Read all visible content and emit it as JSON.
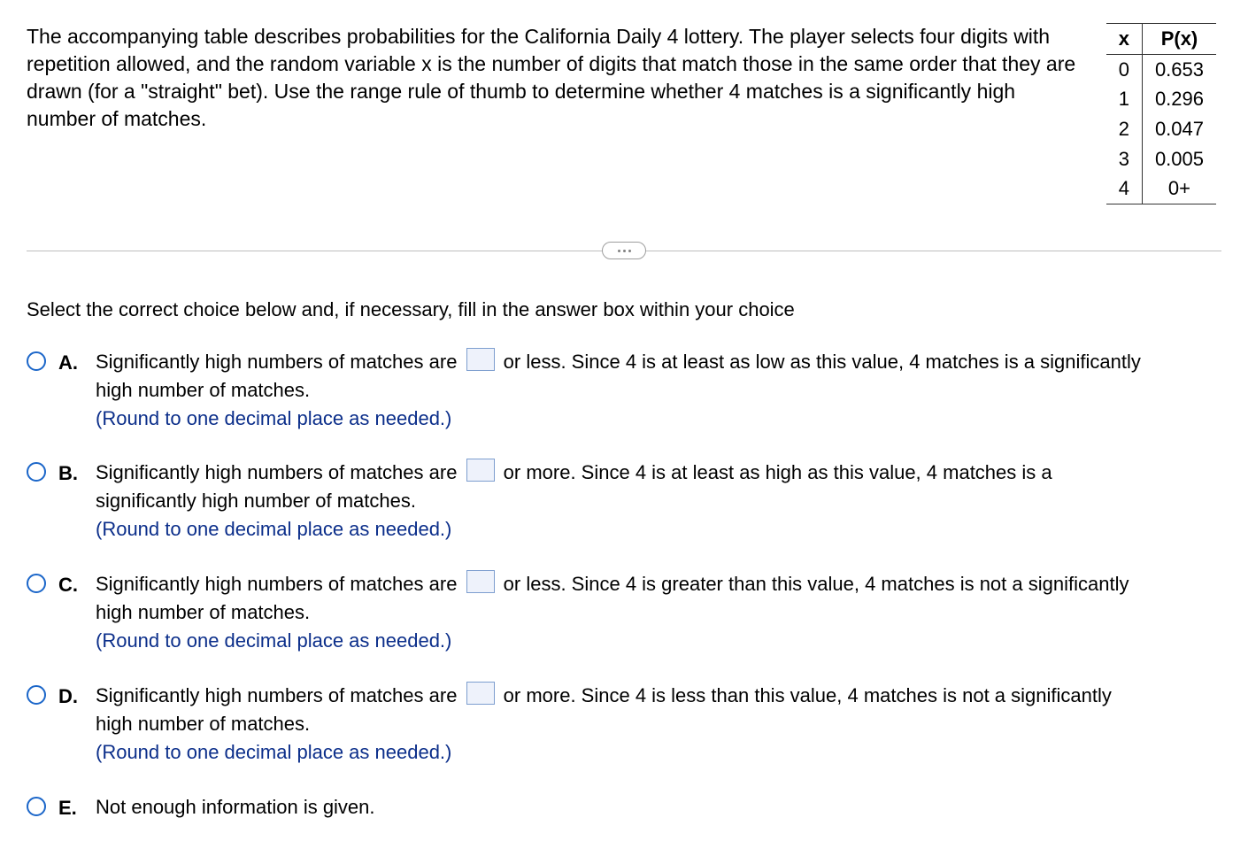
{
  "question": {
    "prompt": "The accompanying table describes probabilities for the California Daily 4 lottery. The player selects four digits with repetition allowed, and the random variable x is the number of digits that match those in the same order that they are drawn (for a \"straight\" bet). Use the range rule of thumb to determine whether 4 matches is a significantly high number of matches.",
    "table": {
      "headers": {
        "x": "x",
        "px": "P(x)"
      },
      "rows": [
        {
          "x": "0",
          "px": "0.653"
        },
        {
          "x": "1",
          "px": "0.296"
        },
        {
          "x": "2",
          "px": "0.047"
        },
        {
          "x": "3",
          "px": "0.005"
        },
        {
          "x": "4",
          "px": "0+"
        }
      ]
    },
    "instruction": "Select the correct choice below and, if necessary, fill in the answer box within your choice",
    "hint": "(Round to one decimal place as needed.)",
    "choices": {
      "A": {
        "pre": "Significantly high numbers of matches are ",
        "post": " or less. Since 4 is at least as low as this value, 4 matches is a significantly high number of matches.",
        "has_box": true
      },
      "B": {
        "pre": "Significantly high numbers of matches are ",
        "post": " or more. Since 4 is at least as high as this value, 4 matches is a significantly high number of matches.",
        "has_box": true
      },
      "C": {
        "pre": "Significantly high numbers of matches are ",
        "post": " or less. Since 4 is greater than this value, 4 matches is not a significantly high number of matches.",
        "has_box": true
      },
      "D": {
        "pre": "Significantly high numbers of matches are ",
        "post": " or more. Since 4 is less than this value, 4 matches is not a significantly high number of matches.",
        "has_box": true
      },
      "E": {
        "pre": "Not enough information is given.",
        "post": "",
        "has_box": false
      }
    },
    "labels": {
      "A": "A.",
      "B": "B.",
      "C": "C.",
      "D": "D.",
      "E": "E."
    }
  }
}
